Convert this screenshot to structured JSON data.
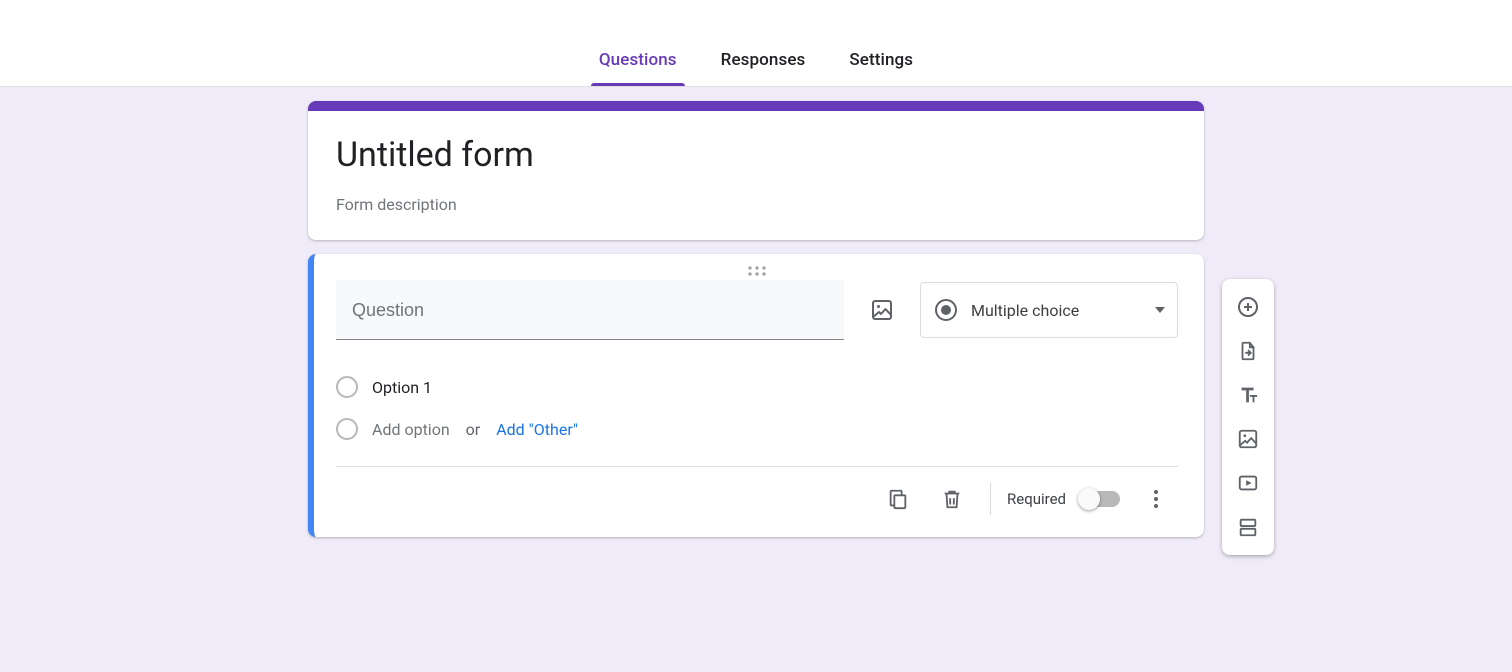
{
  "tabs": {
    "questions": "Questions",
    "responses": "Responses",
    "settings": "Settings"
  },
  "form": {
    "title": "Untitled form",
    "description_placeholder": "Form description"
  },
  "question": {
    "placeholder": "Question",
    "value": "",
    "type_label": "Multiple choice",
    "options": [
      "Option 1"
    ],
    "add_option_text": "Add option",
    "or_text": "or",
    "add_other_text": "Add \"Other\"",
    "required_label": "Required",
    "required": false
  }
}
